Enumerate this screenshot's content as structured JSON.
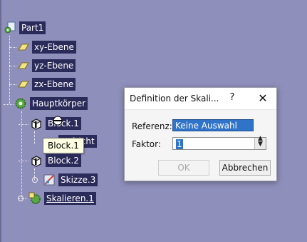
{
  "tree": {
    "root_label": "Part1",
    "planes": [
      "xy-Ebene",
      "yz-Ebene",
      "zx-Ebene"
    ],
    "body_label": "Hauptkörper",
    "block1_label": "Block.1",
    "block1_child_label": "Draufsicht",
    "block1_child_visible": "aufsicht",
    "block2_label": "Block.2",
    "sketch_label": "Skizze.3",
    "scale_label": "Skalieren.1"
  },
  "tooltip": {
    "text": "Block.1"
  },
  "dialog": {
    "title": "Definition der Skali...",
    "help_label": "?",
    "close_label": "✕",
    "reference_label": "Referenz:",
    "reference_value": "Keine Auswahl",
    "factor_label": "Faktor:",
    "factor_value": "1",
    "ok_label": "OK",
    "cancel_label": "Abbrechen"
  },
  "colors": {
    "background": "#8f8fbc",
    "tree_label_bg": "#2b2b5a",
    "selection_blue": "#2f74c9"
  },
  "icons": {
    "root": "part-icon",
    "plane": "plane-icon",
    "body": "body-gear-icon",
    "block": "pad-block-icon",
    "sketch": "sketch-icon",
    "scale": "scale-icon"
  }
}
